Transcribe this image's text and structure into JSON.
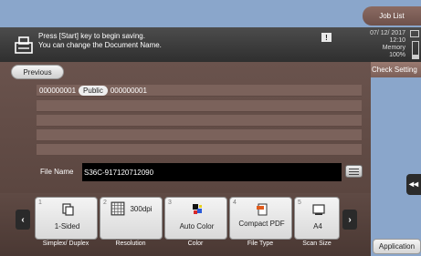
{
  "header": {
    "job_list_label": "Job List"
  },
  "message": {
    "line1": "Press [Start] key to begin saving.",
    "line2": "You can change the Document Name.",
    "alert_label": "!"
  },
  "status": {
    "date": "07/ 12/ 2017",
    "time": "12:10",
    "memory_label": "Memory",
    "memory_value": "100%"
  },
  "nav": {
    "previous_label": "Previous",
    "check_settings_label": "Check Setting",
    "application_label": "Application",
    "collapse_symbol": "◂◂"
  },
  "document_list": {
    "box_number": "000000001",
    "box_type": "Public",
    "box_name": "000000001"
  },
  "file_name": {
    "label": "File Name",
    "value": "S36C-917120712090"
  },
  "shortcuts": [
    {
      "number": "1",
      "value": "1-Sided",
      "caption": "Simplex/ Duplex",
      "icon": "single-page-icon"
    },
    {
      "number": "2",
      "value": "300dpi",
      "caption": "Resolution",
      "icon": "resolution-grid-icon"
    },
    {
      "number": "3",
      "value": "Auto Color",
      "caption": "Color",
      "icon": "color-blocks-icon"
    },
    {
      "number": "4",
      "value": "Compact PDF",
      "caption": "File Type",
      "icon": "pdf-file-icon"
    },
    {
      "number": "5",
      "value": "A4",
      "caption": "Scan Size",
      "icon": "page-size-icon"
    }
  ],
  "colors": {
    "accent_bar": "#8aa6cb",
    "panel": "#6a534d",
    "message_bar": "#3a3a3a"
  }
}
